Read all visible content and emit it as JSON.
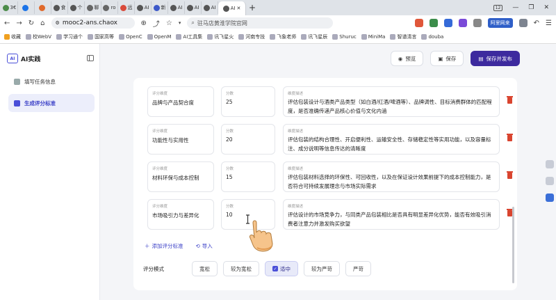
{
  "browser": {
    "tabs": [
      {
        "label": "3€",
        "color": "#4c8c4a"
      },
      {
        "label": "",
        "color": "#1a73e8"
      },
      {
        "label": "",
        "color": "#e06a2c"
      },
      {
        "label": "食",
        "color": "#555555"
      },
      {
        "label": "个",
        "color": "#555555"
      },
      {
        "label": "聊",
        "color": "#666666"
      },
      {
        "label": "ro",
        "color": "#666666"
      },
      {
        "label": "远",
        "color": "#d94a3a"
      },
      {
        "label": "AI",
        "color": "#555555"
      },
      {
        "label": "新",
        "color": "#3d59c9"
      },
      {
        "label": "AI",
        "color": "#555555"
      },
      {
        "label": "AI",
        "color": "#555555"
      },
      {
        "label": "AI",
        "color": "#555555"
      },
      {
        "label": "AI",
        "color": "#555555",
        "active": true
      }
    ],
    "tab_count": "12",
    "url": "mooc2-ans.chaox",
    "search_text": "驻马店黄淮学院官网",
    "ext_label": "阿里网来",
    "bookmarks": [
      "收藏",
      "校WebV",
      "学习通个",
      "国家高等",
      "OpenC",
      "OpenM",
      "AI工具集",
      "讯飞星火",
      "河南专技",
      "飞象老师",
      "讯飞星辰",
      "Shuruc",
      "MiniMa",
      "智谱清言",
      "douba"
    ]
  },
  "sidebar": {
    "brand_logo": "AI",
    "brand_title": "AI实践",
    "items": [
      {
        "label": "填写任务信息",
        "active": false
      },
      {
        "label": "生成评分标准",
        "active": true
      }
    ]
  },
  "actions": {
    "preview": "预览",
    "save": "保存",
    "save_publish": "保存并发布"
  },
  "rubric": {
    "dim_label": "评分维度",
    "score_label": "分数",
    "desc_label": "维度描述",
    "rows": [
      {
        "dimension": "品牌与产品契合度",
        "score": "25",
        "description": "评估包装设计与酒类产品类型（如白酒/红酒/啤酒等）、品牌调性、目标消费群体的匹配程度，是否准确传递产品核心价值与文化内涵"
      },
      {
        "dimension": "功能性与实用性",
        "score": "20",
        "description": "评估包装的结构合理性、开启便利性、运输安全性、存储稳定性等实用功能，以及容量标注、成分说明等信息传达的清晰度"
      },
      {
        "dimension": "材料环保与成本控制",
        "score": "15",
        "description": "评估包装材料选择的环保性、可回收性，以及在保证设计效果前提下的成本控制能力，是否符合可持续发展理念与市场实际需求"
      },
      {
        "dimension": "市场吸引力与差异化",
        "score": "10",
        "description": "评估设计的市场竞争力，与同类产品包装相比是否具有明显差异化优势，能否有效吸引消费者注意力并激发购买欲望"
      }
    ],
    "add_label": "添加评分标准",
    "import_label": "导入"
  },
  "mode": {
    "label": "评分模式",
    "options": [
      {
        "label": "宽松",
        "selected": false
      },
      {
        "label": "较为宽松",
        "selected": false
      },
      {
        "label": "适中",
        "selected": true
      },
      {
        "label": "较为严苛",
        "selected": false
      },
      {
        "label": "严苛",
        "selected": false
      }
    ]
  },
  "colors": {
    "brand": "#3d2a9e",
    "accent": "#4a4fd8",
    "delete": "#d9442f"
  }
}
